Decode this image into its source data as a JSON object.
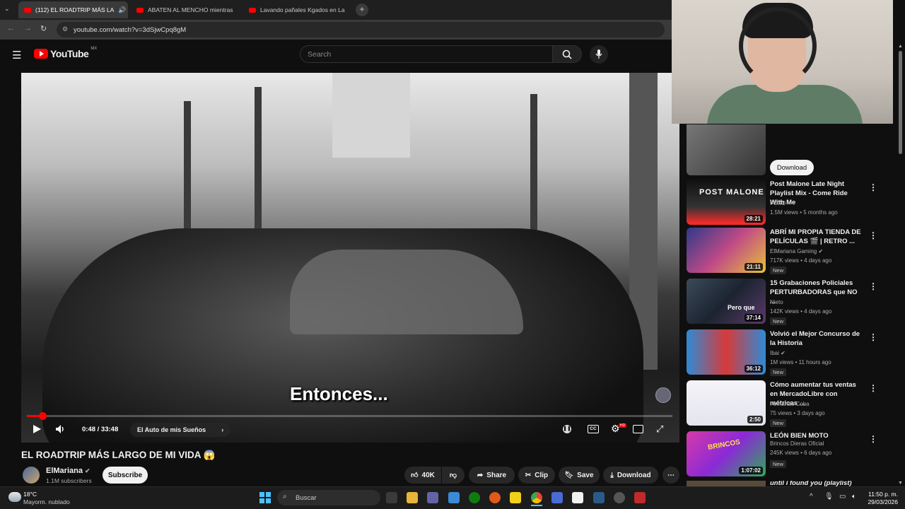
{
  "browser": {
    "tabs": [
      {
        "label": "(112) EL ROADTRIP MÁS LA"
      },
      {
        "label": "ABATEN AL MENCHO mientras"
      },
      {
        "label": "Lavando pañales Kgados en La"
      }
    ],
    "url": "youtube.com/watch?v=3dSjwCpq8gM"
  },
  "header": {
    "logo_text": "YouTube",
    "region": "MX",
    "search_placeholder": "Search"
  },
  "player": {
    "caption": "Entonces...",
    "time": "0:48 / 33:48",
    "chapter": "El Auto de mis Sueños",
    "progress_fraction": 0.024
  },
  "video_info": {
    "title": "EL ROADTRIP MÁS LARGO DE MI VIDA 😱",
    "channel": "ElMariana",
    "subscribers": "1.1M subscribers",
    "subscribe_label": "Subscribe",
    "likes": "40K",
    "share_label": "Share",
    "clip_label": "Clip",
    "save_label": "Save",
    "download_label": "Download"
  },
  "sidebar": {
    "download_label": "Download",
    "items": [
      {
        "title": "Post Malone Late Night Playlist Mix - Come Ride With Me",
        "channel": "FCXO",
        "meta": "1.5M views • 5 months ago",
        "duration": "28:21",
        "new": "",
        "thumb_text": "POST MALONE"
      },
      {
        "title": "ABRÍ MI PROPIA TIENDA DE PELÍCULAS 🎬 | RETRO ...",
        "channel": "ElMariana Gaming ✔",
        "meta": "717K views • 4 days ago",
        "duration": "21:11",
        "new": "New",
        "thumb_text": ""
      },
      {
        "title": "15 Grabaciones Policiales PERTURBADORAS que NO ...",
        "channel": "Nieto",
        "meta": "142K views • 4 days ago",
        "duration": "37:14",
        "new": "New",
        "thumb_text": "Pero que"
      },
      {
        "title": "Volvió el Mejor Concurso de la Historia",
        "channel": "Ibai ✔",
        "meta": "1M views • 11 hours ago",
        "duration": "36:12",
        "new": "New",
        "thumb_text": ""
      },
      {
        "title": "Cómo aumentar tus ventas en MercadoLibre con métricas ...",
        "channel": "Fernando Coba",
        "meta": "75 views • 3 days ago",
        "duration": "2:50",
        "new": "New",
        "thumb_text": ""
      },
      {
        "title": "LEÓN BIEN MOTO",
        "channel": "Brincos Dieras Oficial",
        "meta": "245K views • 6 days ago",
        "duration": "1:07:02",
        "new": "New",
        "thumb_text": "BRINCOS"
      },
      {
        "title": "until i found you (playlist)",
        "channel": "",
        "meta": "",
        "duration": "",
        "new": "",
        "thumb_text": ""
      }
    ]
  },
  "taskbar": {
    "weather_temp": "18°C",
    "weather_desc": "Mayorm. nublado",
    "search_label": "Buscar",
    "time": "11:50 p. m.",
    "date": "29/03/2026"
  },
  "colors": {
    "accent": "#ff0000",
    "background": "#0f0f0f"
  }
}
